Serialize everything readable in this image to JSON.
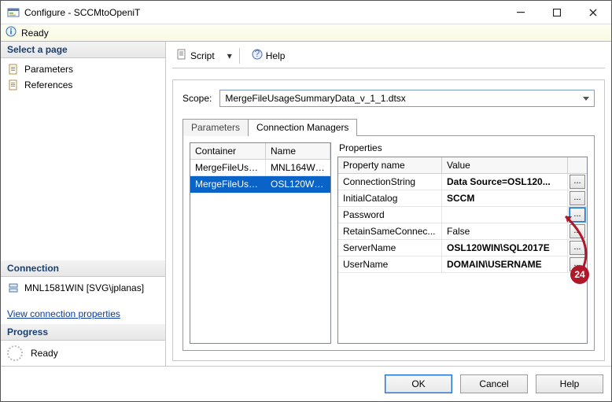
{
  "window": {
    "title": "Configure - SCCMtoOpeniT",
    "status_text": "Ready"
  },
  "sidebar": {
    "select_page_title": "Select a page",
    "items": [
      {
        "label": "Parameters"
      },
      {
        "label": "References"
      }
    ],
    "connection_title": "Connection",
    "connection_server": "MNL1581WIN [SVG\\jplanas]",
    "view_link": "View connection properties",
    "progress_title": "Progress",
    "progress_text": "Ready"
  },
  "toolbar": {
    "script_label": "Script",
    "help_label": "Help"
  },
  "scope": {
    "label": "Scope:",
    "value": "MergeFileUsageSummaryData_v_1_1.dtsx"
  },
  "tabs": {
    "parameters": "Parameters",
    "conn_mgrs": "Connection Managers"
  },
  "conn_grid": {
    "headers": {
      "container": "Container",
      "name": "Name"
    },
    "rows": [
      {
        "container": "MergeFileUsag...",
        "name": "MNL164WIN..."
      },
      {
        "container": "MergeFileUsag...",
        "name": "OSL120WIN..."
      }
    ]
  },
  "props": {
    "title": "Properties",
    "headers": {
      "name": "Property name",
      "value": "Value"
    },
    "rows": [
      {
        "name": "ConnectionString",
        "value": "Data Source=OSL120...",
        "ell": true
      },
      {
        "name": "InitialCatalog",
        "value": "SCCM",
        "ell": true
      },
      {
        "name": "Password",
        "value": "",
        "ell": true,
        "highlight": true
      },
      {
        "name": "RetainSameConnec...",
        "value": "False",
        "ell": true,
        "light": true
      },
      {
        "name": "ServerName",
        "value": "OSL120WIN\\SQL2017E",
        "ell": true
      },
      {
        "name": "UserName",
        "value": "DOMAIN\\USERNAME",
        "ell": true
      }
    ]
  },
  "footer": {
    "ok": "OK",
    "cancel": "Cancel",
    "help": "Help"
  },
  "callout": {
    "number": "24"
  }
}
